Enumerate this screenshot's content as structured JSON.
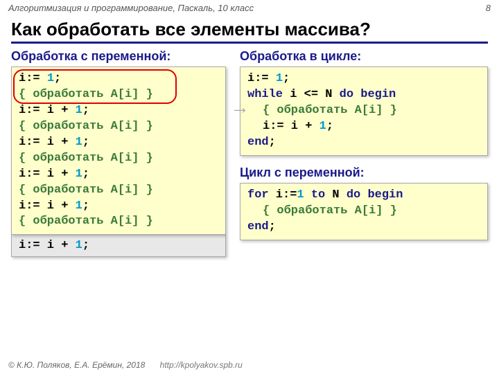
{
  "header": {
    "course": "Алгоритмизация и программирование, Паскаль, 10 класс",
    "page": "8"
  },
  "title": "Как обработать все элементы массива?",
  "left": {
    "label": "Обработка с переменной:",
    "gray_line": {
      "a": "i:= i + ",
      "n": "1",
      "b": ";"
    },
    "lines": [
      {
        "segs": [
          {
            "t": "i:= ",
            "c": "plain"
          },
          {
            "t": "1",
            "c": "num"
          },
          {
            "t": ";",
            "c": "plain"
          }
        ]
      },
      {
        "segs": [
          {
            "t": "{ обработать A[i] }",
            "c": "comment"
          }
        ]
      },
      {
        "segs": [
          {
            "t": "i:= i + ",
            "c": "plain"
          },
          {
            "t": "1",
            "c": "num"
          },
          {
            "t": ";",
            "c": "plain"
          }
        ]
      },
      {
        "segs": [
          {
            "t": "{ обработать A[i] }",
            "c": "comment"
          }
        ]
      },
      {
        "segs": [
          {
            "t": "i:= i + ",
            "c": "plain"
          },
          {
            "t": "1",
            "c": "num"
          },
          {
            "t": ";",
            "c": "plain"
          }
        ]
      },
      {
        "segs": [
          {
            "t": "{ обработать A[i] }",
            "c": "comment"
          }
        ]
      },
      {
        "segs": [
          {
            "t": "i:= i + ",
            "c": "plain"
          },
          {
            "t": "1",
            "c": "num"
          },
          {
            "t": ";",
            "c": "plain"
          }
        ]
      },
      {
        "segs": [
          {
            "t": "{ обработать A[i] }",
            "c": "comment"
          }
        ]
      },
      {
        "segs": [
          {
            "t": "i:= i + ",
            "c": "plain"
          },
          {
            "t": "1",
            "c": "num"
          },
          {
            "t": ";",
            "c": "plain"
          }
        ]
      },
      {
        "segs": [
          {
            "t": "{ обработать A[i] }",
            "c": "comment"
          }
        ]
      }
    ]
  },
  "right": {
    "label1": "Обработка в цикле:",
    "box1": [
      {
        "indent": false,
        "segs": [
          {
            "t": "i:= ",
            "c": "plain"
          },
          {
            "t": "1",
            "c": "num"
          },
          {
            "t": ";",
            "c": "plain"
          }
        ]
      },
      {
        "indent": false,
        "segs": [
          {
            "t": "while",
            "c": "kw"
          },
          {
            "t": " i <= N ",
            "c": "plain"
          },
          {
            "t": "do begin",
            "c": "kw"
          }
        ]
      },
      {
        "indent": true,
        "segs": [
          {
            "t": "{ обработать A[i] }",
            "c": "comment"
          }
        ]
      },
      {
        "indent": true,
        "segs": [
          {
            "t": "i:= i + ",
            "c": "plain"
          },
          {
            "t": "1",
            "c": "num"
          },
          {
            "t": ";",
            "c": "plain"
          }
        ]
      },
      {
        "indent": false,
        "segs": [
          {
            "t": "end",
            "c": "kw"
          },
          {
            "t": ";",
            "c": "plain"
          }
        ]
      }
    ],
    "label2": "Цикл с переменной:",
    "box2": [
      {
        "indent": false,
        "segs": [
          {
            "t": "for",
            "c": "kw"
          },
          {
            "t": " i:=",
            "c": "plain"
          },
          {
            "t": "1",
            "c": "num"
          },
          {
            "t": " ",
            "c": "plain"
          },
          {
            "t": "to",
            "c": "kw"
          },
          {
            "t": " N ",
            "c": "plain"
          },
          {
            "t": "do begin",
            "c": "kw"
          }
        ]
      },
      {
        "indent": true,
        "segs": [
          {
            "t": "{ обработать A[i] }",
            "c": "comment"
          }
        ]
      },
      {
        "indent": false,
        "segs": [
          {
            "t": "end",
            "c": "kw"
          },
          {
            "t": ";",
            "c": "plain"
          }
        ]
      }
    ]
  },
  "footer": {
    "copyright": "© К.Ю. Поляков, Е.А. Ерёмин, 2018",
    "url": "http://kpolyakov.spb.ru"
  }
}
